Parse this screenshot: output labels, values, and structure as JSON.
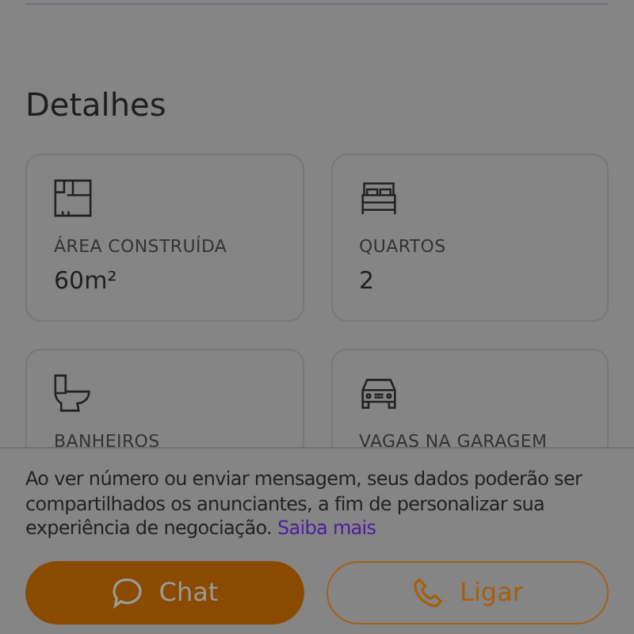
{
  "section_title": "Detalhes",
  "details": [
    {
      "kind": "area",
      "label": "ÁREA CONSTRUÍDA",
      "value": "60m²"
    },
    {
      "kind": "bed",
      "label": "QUARTOS",
      "value": "2"
    },
    {
      "kind": "toilet",
      "label": "BANHEIROS"
    },
    {
      "kind": "car",
      "label": "VAGAS NA GARAGEM"
    }
  ],
  "notice": {
    "text": "Ao ver número ou enviar mensagem, seus dados poderão ser compartilhados os anunciantes, a fim de personalizar sua experiência de negociação.",
    "link": "Saiba mais"
  },
  "buttons": [
    {
      "kind": "chat",
      "label": "Chat"
    },
    {
      "kind": "call",
      "label": "Ligar"
    }
  ]
}
